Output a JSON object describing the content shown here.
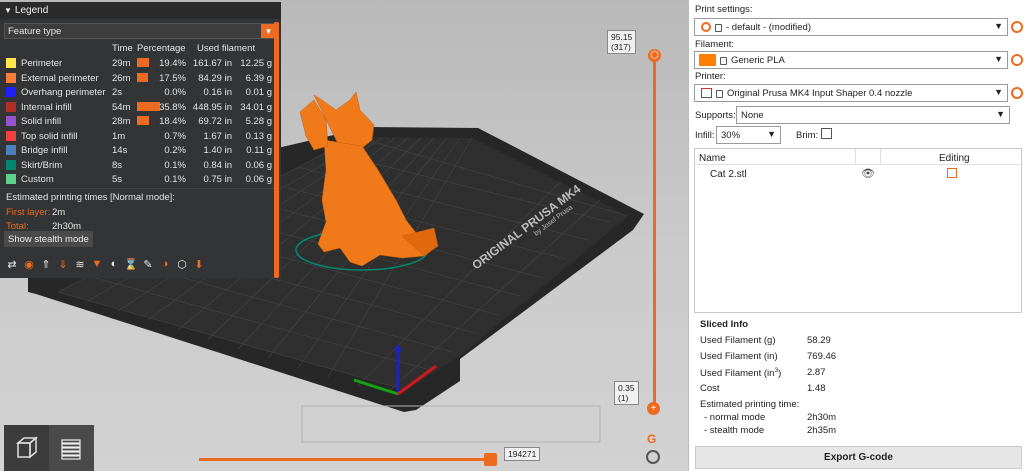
{
  "legend": {
    "title": "Legend",
    "view_type": "Feature type",
    "columns": {
      "time": "Time",
      "percentage": "Percentage",
      "used_filament": "Used filament"
    },
    "rows": [
      {
        "name": "Perimeter",
        "color": "#FFE64D",
        "time": "29m",
        "pct": "19.4%",
        "pct_value": 19.4,
        "len": "161.67 in",
        "mass": "12.25 g"
      },
      {
        "name": "External perimeter",
        "color": "#FF7D38",
        "time": "26m",
        "pct": "17.5%",
        "pct_value": 17.5,
        "len": "84.29 in",
        "mass": "6.39 g"
      },
      {
        "name": "Overhang perimeter",
        "color": "#1F1FFF",
        "time": "2s",
        "pct": "0.0%",
        "pct_value": 0.0,
        "len": "0.16 in",
        "mass": "0.01 g"
      },
      {
        "name": "Internal infill",
        "color": "#B03029",
        "time": "54m",
        "pct": "35.8%",
        "pct_value": 35.8,
        "len": "448.95 in",
        "mass": "34.01 g"
      },
      {
        "name": "Solid infill",
        "color": "#9654CC",
        "time": "28m",
        "pct": "18.4%",
        "pct_value": 18.4,
        "len": "69.72 in",
        "mass": "5.28 g"
      },
      {
        "name": "Top solid infill",
        "color": "#F04040",
        "time": "1m",
        "pct": "0.7%",
        "pct_value": 0.7,
        "len": "1.67 in",
        "mass": "0.13 g"
      },
      {
        "name": "Bridge infill",
        "color": "#4D80BA",
        "time": "14s",
        "pct": "0.2%",
        "pct_value": 0.2,
        "len": "1.40 in",
        "mass": "0.11 g"
      },
      {
        "name": "Skirt/Brim",
        "color": "#00876E",
        "time": "8s",
        "pct": "0.1%",
        "pct_value": 0.1,
        "len": "0.84 in",
        "mass": "0.06 g"
      },
      {
        "name": "Custom",
        "color": "#5ED18A",
        "time": "5s",
        "pct": "0.1%",
        "pct_value": 0.1,
        "len": "0.75 in",
        "mass": "0.06 g"
      }
    ],
    "estimated_title": "Estimated printing times [Normal mode]:",
    "first_layer_label": "First layer:",
    "first_layer_value": "2m",
    "total_label": "Total:",
    "total_value": "2h30m",
    "stealth_button": "Show stealth mode",
    "option_icons": [
      "travel-icon",
      "wipe-icon",
      "retractions-icon",
      "deretractions-icon",
      "seams-icon",
      "tool-changes-icon",
      "color-changes-icon",
      "pause-icon",
      "custom-gcode-icon",
      "center-of-gravity-icon",
      "shells-icon",
      "tool-marker-icon"
    ]
  },
  "bed": {
    "brand_text": "ORIGINAL PRUSA MK4",
    "maker_text": "by Josef Prusa"
  },
  "layer_slider": {
    "top_value": "95.15",
    "top_layer": "(317)",
    "bottom_value": "0.35",
    "bottom_layer": "(1)"
  },
  "move_slider": {
    "value": "194271"
  },
  "sidebar": {
    "print_settings_label": "Print settings:",
    "print_settings_value": "- default - (modified)",
    "filament_label": "Filament:",
    "filament_value": "Generic PLA",
    "filament_color": "#FF8000",
    "printer_label": "Printer:",
    "printer_value": "Original Prusa MK4 Input Shaper 0.4 nozzle",
    "supports_label": "Supports:",
    "supports_value": "None",
    "infill_label": "Infill:",
    "infill_value": "30%",
    "brim_label": "Brim:",
    "objects_col_name": "Name",
    "objects_col_editing": "Editing",
    "objects": [
      {
        "name": "Cat 2.stl"
      }
    ]
  },
  "sliced_info": {
    "title": "Sliced Info",
    "rows": [
      {
        "label": "Used Filament (g)",
        "value": "58.29"
      },
      {
        "label": "Used Filament (in)",
        "value": "769.46"
      },
      {
        "label": "Used Filament (in",
        "sup": "3",
        "label_end": ")",
        "value": "2.87"
      },
      {
        "label": "Cost",
        "value": "1.48"
      }
    ],
    "time_title": "Estimated printing time:",
    "normal_label": "- normal mode",
    "normal_value": "2h30m",
    "stealth_label": "- stealth mode",
    "stealth_value": "2h35m"
  },
  "export_button": "Export G-code",
  "accent_color": "#ED6B21"
}
